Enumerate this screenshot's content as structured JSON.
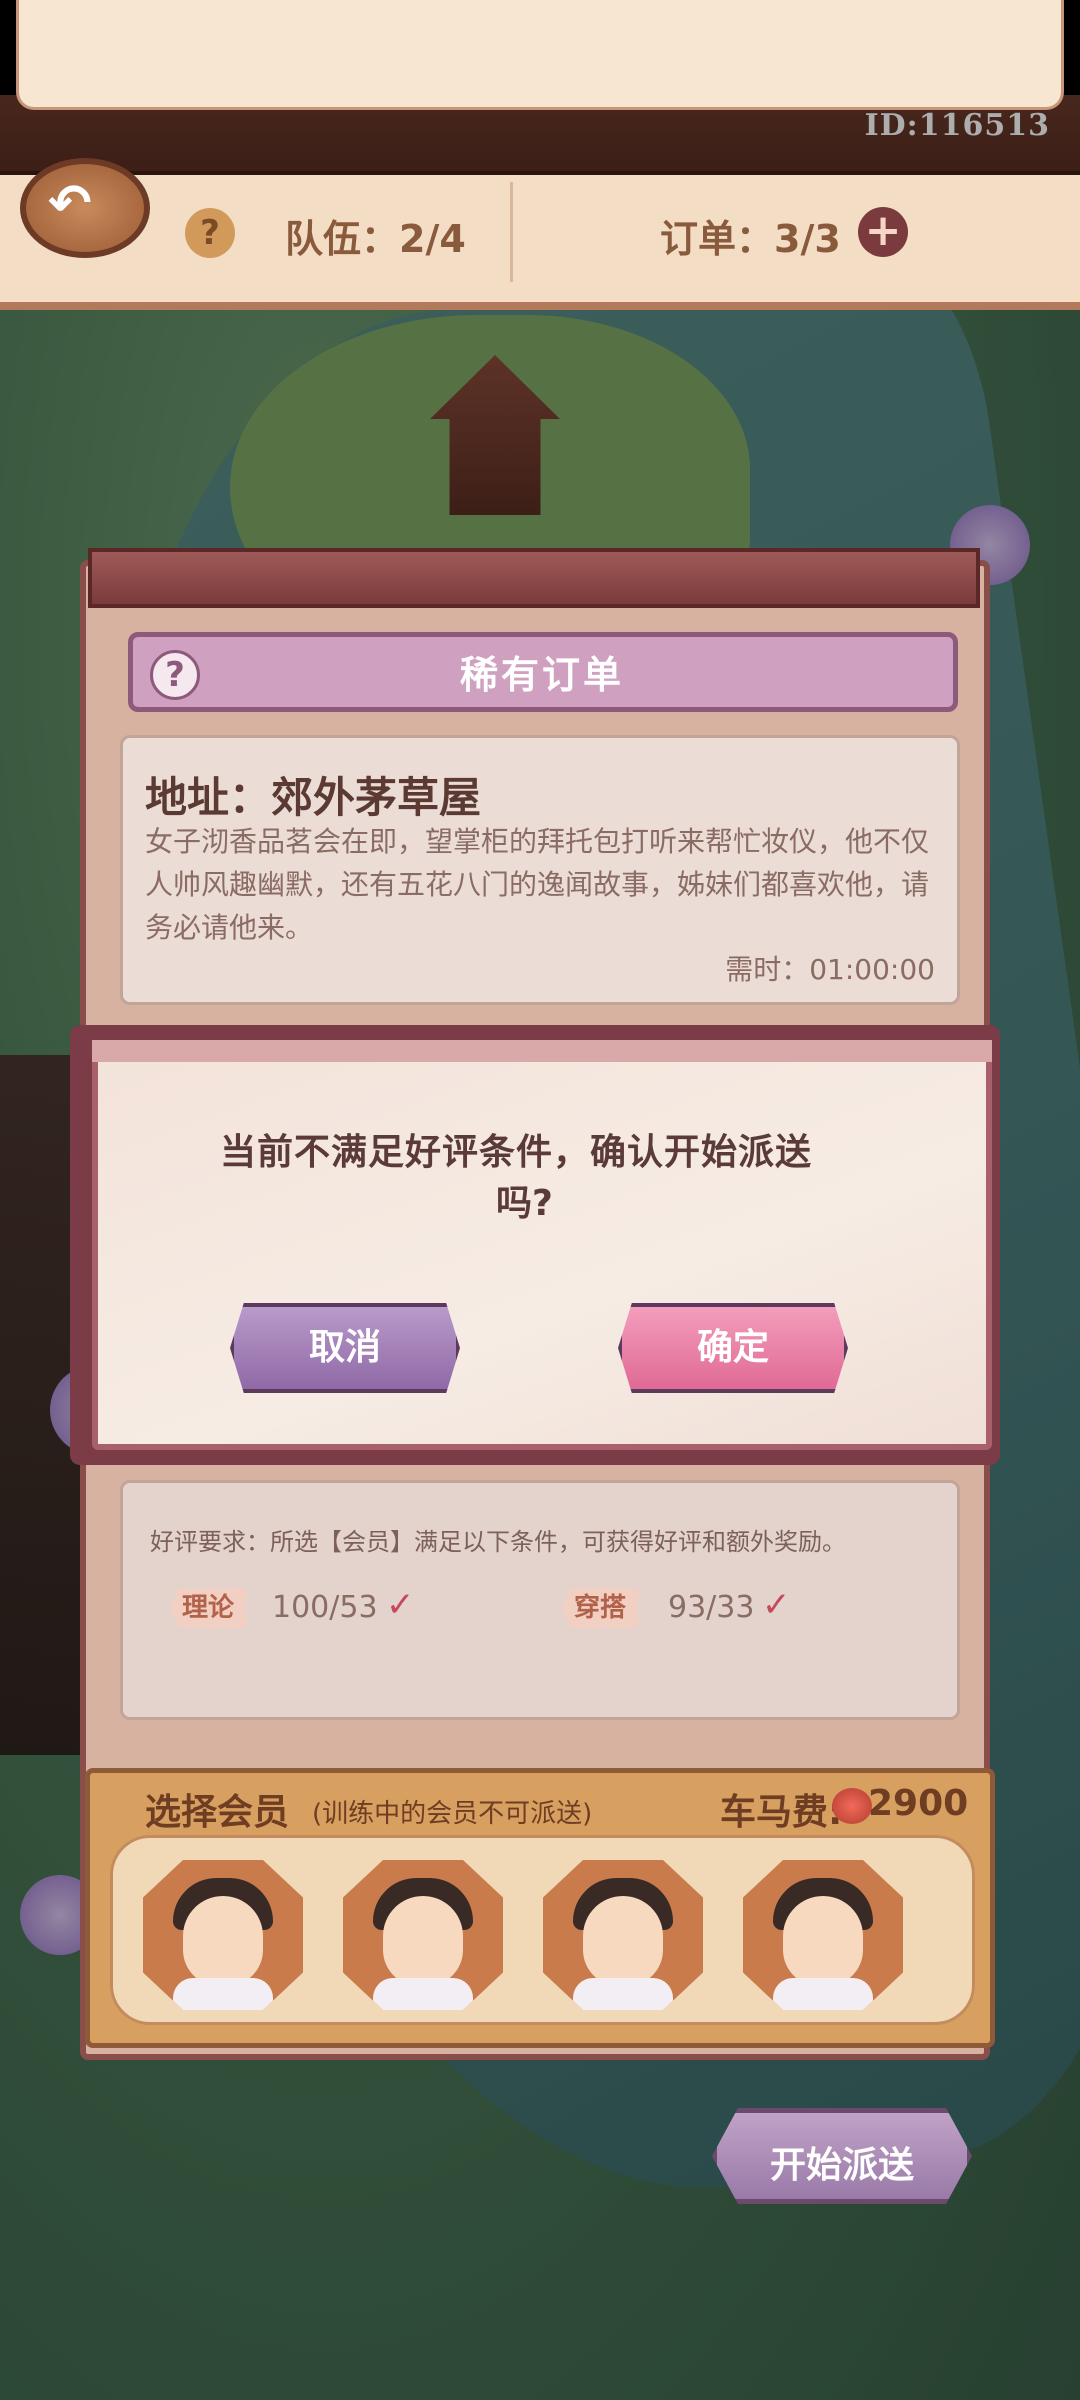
{
  "header": {
    "id_text": "ID:116513",
    "team_label": "队伍：2/4",
    "order_label": "订单：3/3"
  },
  "order": {
    "panel_title": "稀有订单",
    "address": "地址：郊外茅草屋",
    "description": "女子沏香品茗会在即，望掌柜的拜托包打听来帮忙妆仪，他不仅人帅风趣幽默，还有五花八门的逸闻故事，姊妹们都喜欢他，请务必请他来。",
    "time_required": "需时：01:00:00",
    "good_review_requirement": "好评要求：所选【会员】满足以下条件，可获得好评和额外奖励。",
    "requirements": [
      {
        "tag": "理论",
        "value": "100/53"
      },
      {
        "tag": "穿搭",
        "value": "93/33"
      }
    ]
  },
  "members": {
    "title": "选择会员",
    "subtitle": "(训练中的会员不可派送)",
    "fee_label": "车马费:",
    "fee_value": "2900"
  },
  "start_button": "开始派送",
  "dialog": {
    "message_line1": "当前不满足好评条件，确认开始派送",
    "message_line2": "吗?",
    "cancel": "取消",
    "confirm": "确定"
  },
  "icons": {
    "back": "back-arrow-icon",
    "help": "question-icon",
    "add": "plus-icon",
    "check": "check-icon",
    "fee": "coin-icon"
  }
}
